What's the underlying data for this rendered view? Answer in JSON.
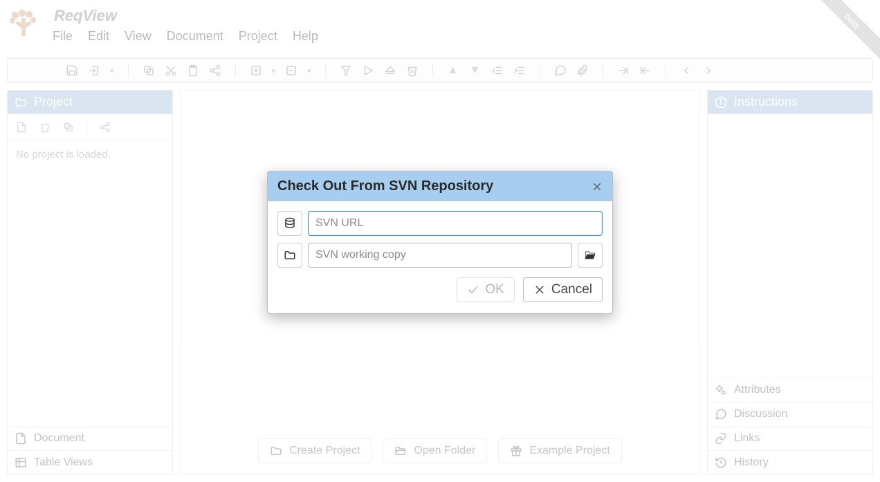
{
  "app": {
    "title": "ReqView",
    "ribbon": "beta"
  },
  "menu": {
    "file": "File",
    "edit": "Edit",
    "view": "View",
    "document": "Document",
    "project": "Project",
    "help": "Help"
  },
  "left": {
    "header": "Project",
    "empty_message": "No project is loaded.",
    "footer_document": "Document",
    "footer_tableviews": "Table Views"
  },
  "center": {
    "create_project": "Create Project",
    "open_folder": "Open Folder",
    "example_project": "Example Project"
  },
  "right": {
    "header": "Instructions",
    "rows": {
      "attributes": "Attributes",
      "discussion": "Discussion",
      "links": "Links",
      "history": "History"
    }
  },
  "dialog": {
    "title": "Check Out From SVN Repository",
    "svn_url_placeholder": "SVN URL",
    "working_copy_placeholder": "SVN working copy",
    "ok": "OK",
    "cancel": "Cancel"
  }
}
